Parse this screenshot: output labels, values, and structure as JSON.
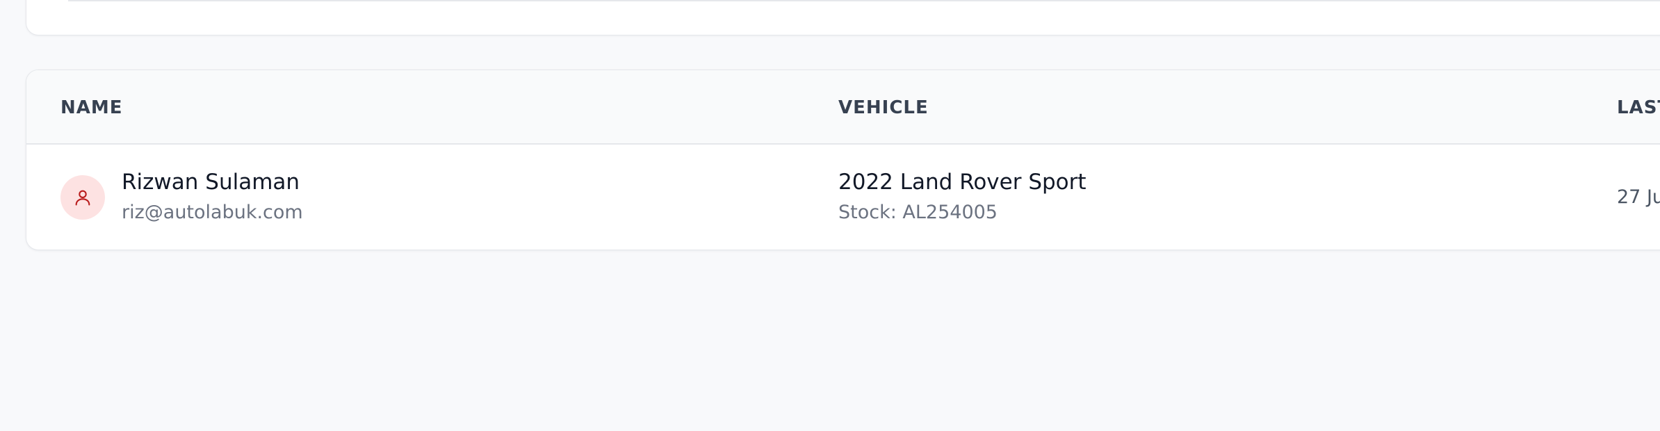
{
  "table": {
    "headers": {
      "name": "NAME",
      "vehicle": "VEHICLE",
      "last": "LAST"
    },
    "rows": [
      {
        "name": "Rizwan Sulaman",
        "email": "riz@autolabuk.com",
        "vehicle": "2022 Land Rover Sport",
        "stock": "Stock: AL254005",
        "last": "27 Ju"
      }
    ]
  },
  "icons": {
    "avatar": "user-icon"
  },
  "colors": {
    "avatar_bg": "#fde2e2",
    "avatar_icon": "#b91c1c",
    "header_bg": "#f9fafb",
    "page_bg": "#f8f9fb"
  }
}
